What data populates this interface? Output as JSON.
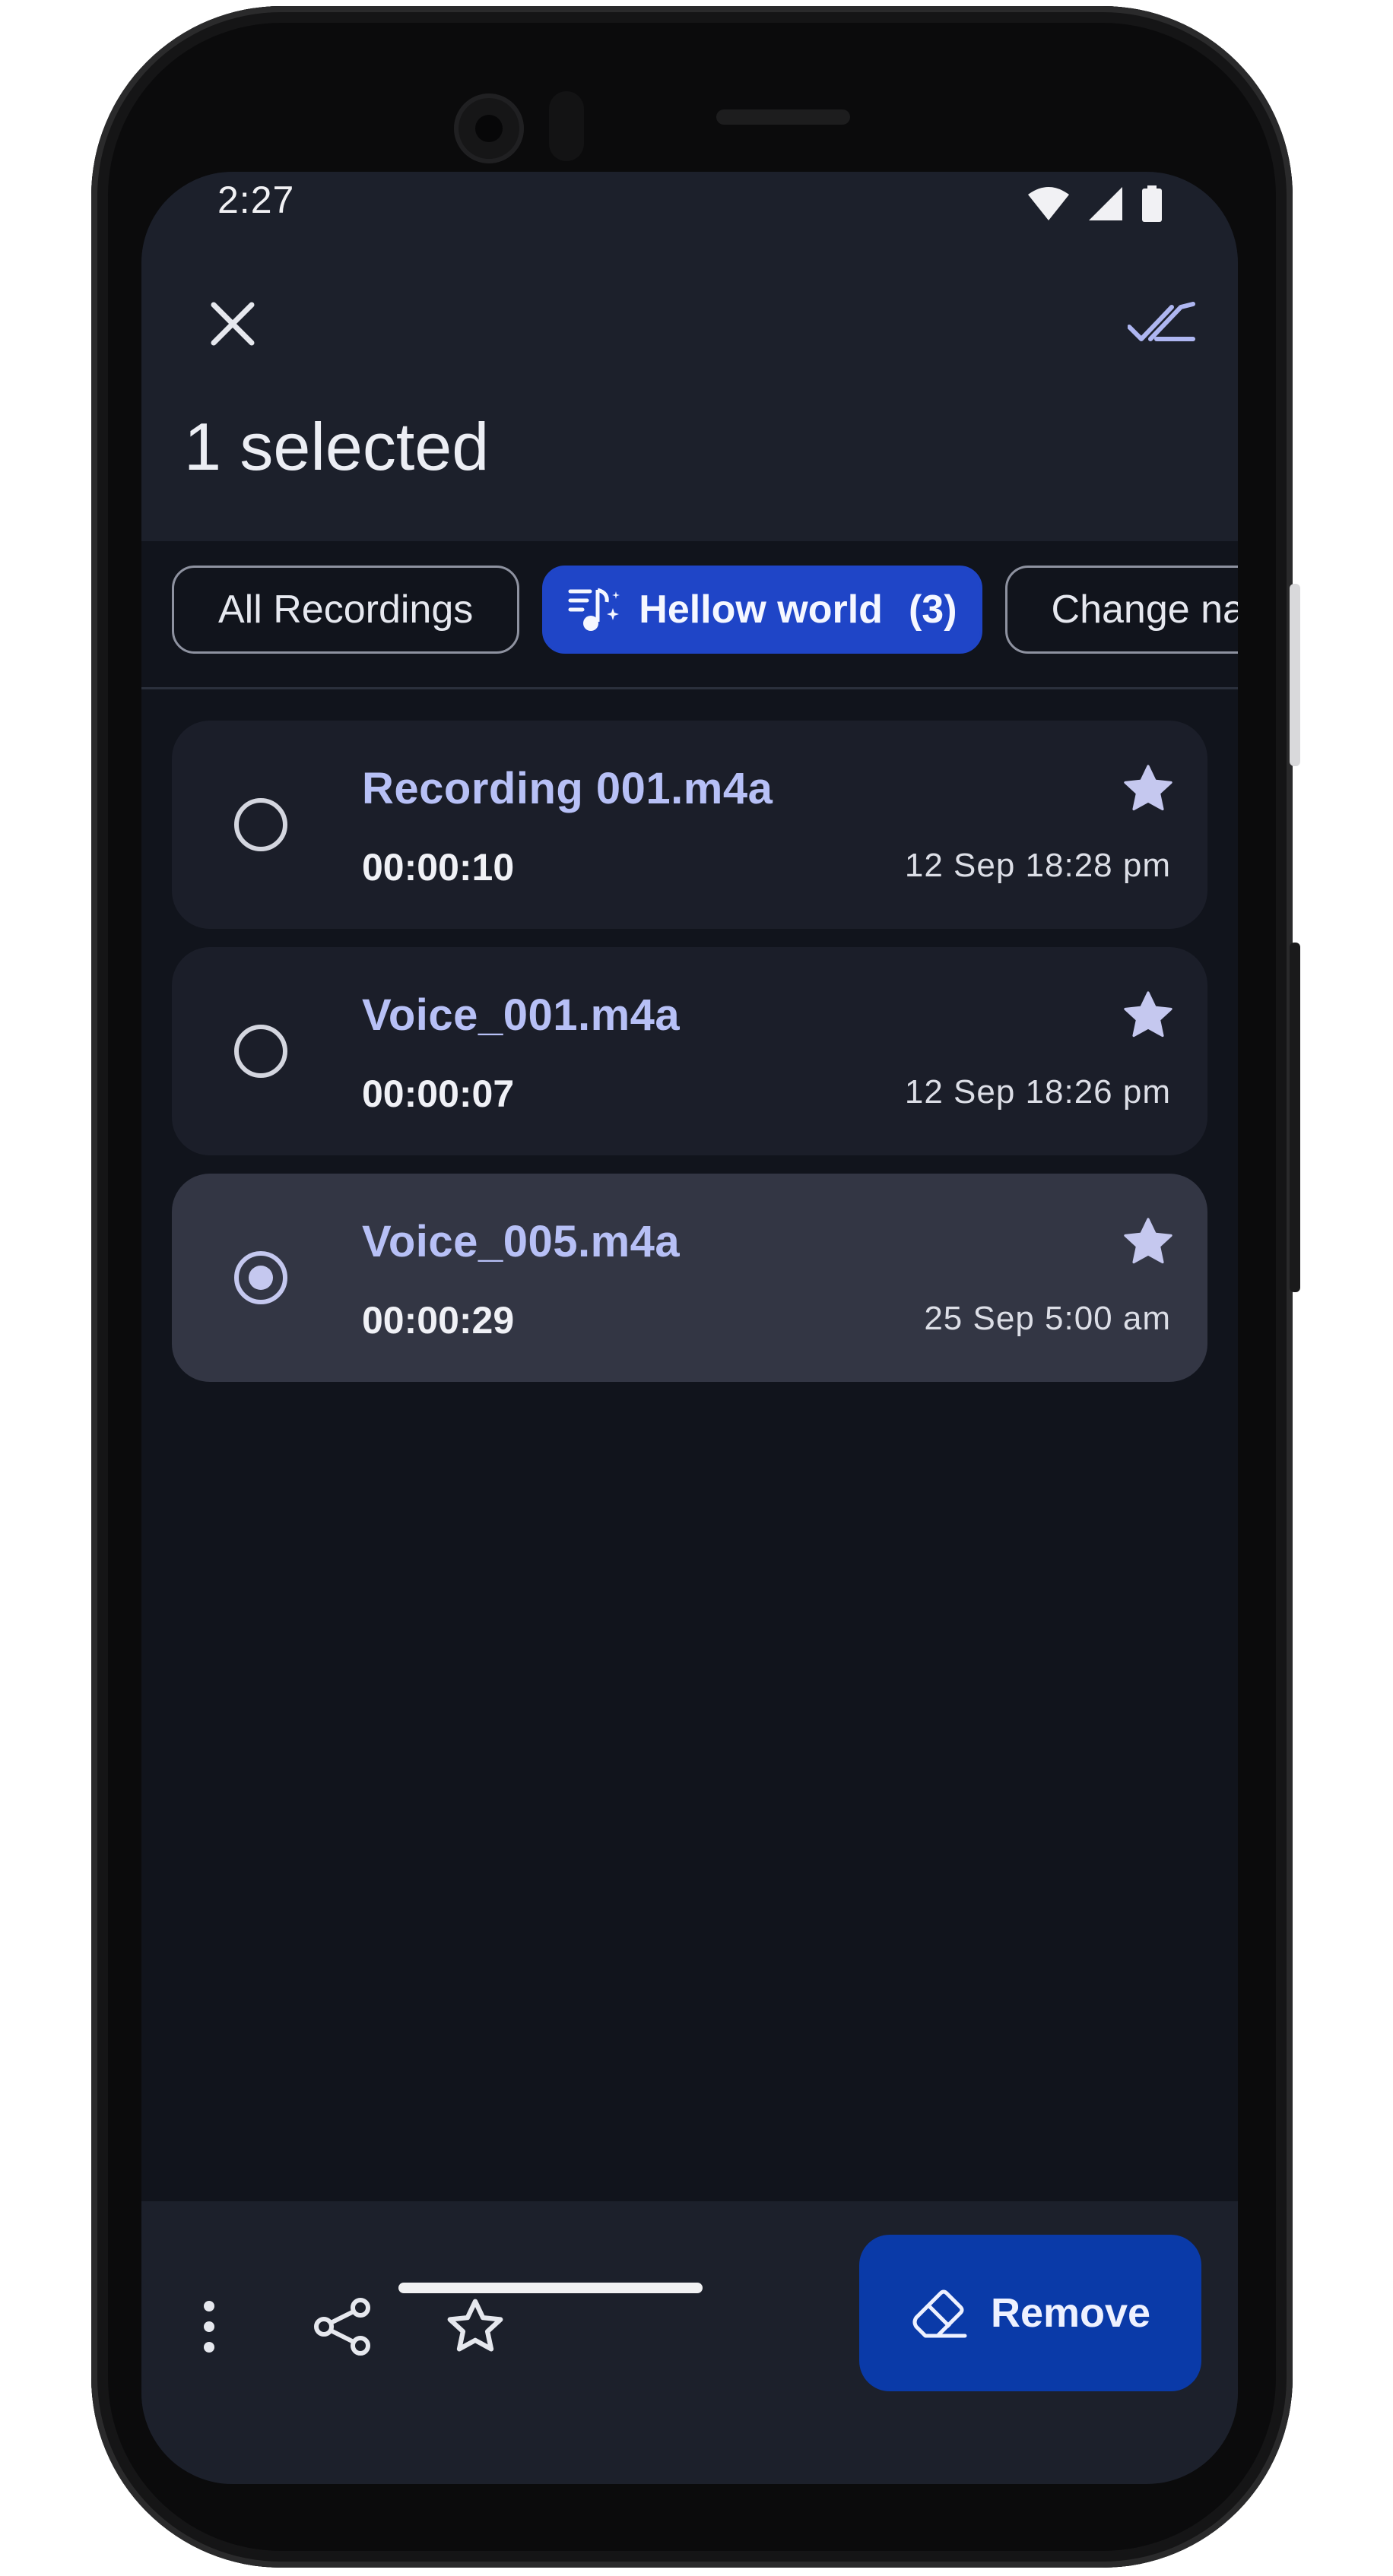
{
  "status_bar": {
    "time": "2:27",
    "icons": [
      "wifi-icon",
      "signal-icon",
      "battery-icon"
    ]
  },
  "header": {
    "close_icon": "close-icon",
    "select_all_icon": "select-all-icon",
    "title": "1 selected"
  },
  "chips": [
    {
      "label": "All Recordings",
      "active": false
    },
    {
      "label": "Hellow world",
      "count": "(3)",
      "icon": "music-note-icon",
      "active": true
    },
    {
      "label": "Change nan",
      "active": false
    }
  ],
  "recordings": [
    {
      "name": "Recording 001.m4a",
      "duration": "00:00:10",
      "date": "12 Sep 18:28 pm",
      "starred": true,
      "selected": false
    },
    {
      "name": "Voice_001.m4a",
      "duration": "00:00:07",
      "date": "12 Sep 18:26 pm",
      "starred": true,
      "selected": false
    },
    {
      "name": "Voice_005.m4a",
      "duration": "00:00:29",
      "date": "25 Sep 5:00 am",
      "starred": true,
      "selected": true
    }
  ],
  "bottom_bar": {
    "more_icon": "more-vert-icon",
    "share_icon": "share-icon",
    "star_icon": "star-outline-icon",
    "remove_label": "Remove",
    "remove_icon": "eraser-icon"
  },
  "colors": {
    "accent": "#1f45c7",
    "remove_button": "#0a3aa8",
    "recording_name": "#b7c0f6",
    "star": "#c5c8ef"
  }
}
